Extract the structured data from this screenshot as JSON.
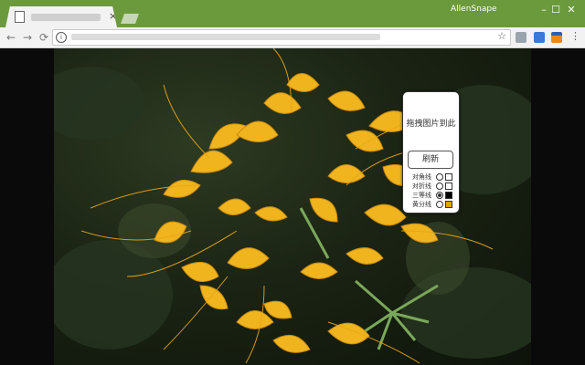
{
  "browser": {
    "profile_name": "AllenSnape",
    "tab_close_glyph": "×",
    "window_controls": {
      "minimize": "–",
      "maximize": "☐",
      "close": "✕"
    },
    "nav": {
      "back": "←",
      "forward": "→",
      "reload": "⟳"
    },
    "omnibox": {
      "info_glyph": "i",
      "star_glyph": "☆"
    },
    "menu_glyph": "⋮"
  },
  "panel": {
    "drop_text": "拖拽图片到此",
    "refresh_label": "刷新",
    "options": [
      {
        "label": "对角线",
        "selected": false,
        "color": "#ffffff"
      },
      {
        "label": "对折线",
        "selected": false,
        "color": "#ffffff"
      },
      {
        "label": "三等线",
        "selected": true,
        "color": "#000000"
      },
      {
        "label": "黄分线",
        "selected": false,
        "color": "#e0a000"
      }
    ]
  },
  "colors": {
    "titlebar": "#6b9a3c",
    "flower": "#f0b41e",
    "flower_shadow": "#c98a0c",
    "stem": "#7aa85a"
  }
}
